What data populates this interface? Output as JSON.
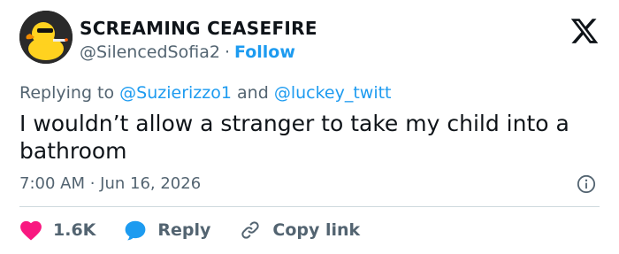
{
  "author": {
    "display_name": "SCREAMING CEASEFIRE",
    "handle": "@SilencedSofia2",
    "separator": "·",
    "follow_label": "Follow"
  },
  "reply_context": {
    "prefix": "Replying to",
    "mention_1": "@Suzierizzo1",
    "conjunction": "and",
    "mention_2": "@luckey_twitt"
  },
  "tweet": {
    "text": "I wouldn’t allow a stranger to take my child into a bathroom",
    "timestamp": "7:00 AM · Jun 16, 2026"
  },
  "actions": {
    "likes": "1.6K",
    "reply_label": "Reply",
    "copy_link_label": "Copy link"
  },
  "colors": {
    "accent": "#1d9bf0",
    "heart": "#f91880",
    "muted": "#536471",
    "text": "#0f1419"
  },
  "icons": [
    "x-logo-icon",
    "info-icon",
    "heart-icon",
    "reply-bubble-icon",
    "link-icon"
  ]
}
